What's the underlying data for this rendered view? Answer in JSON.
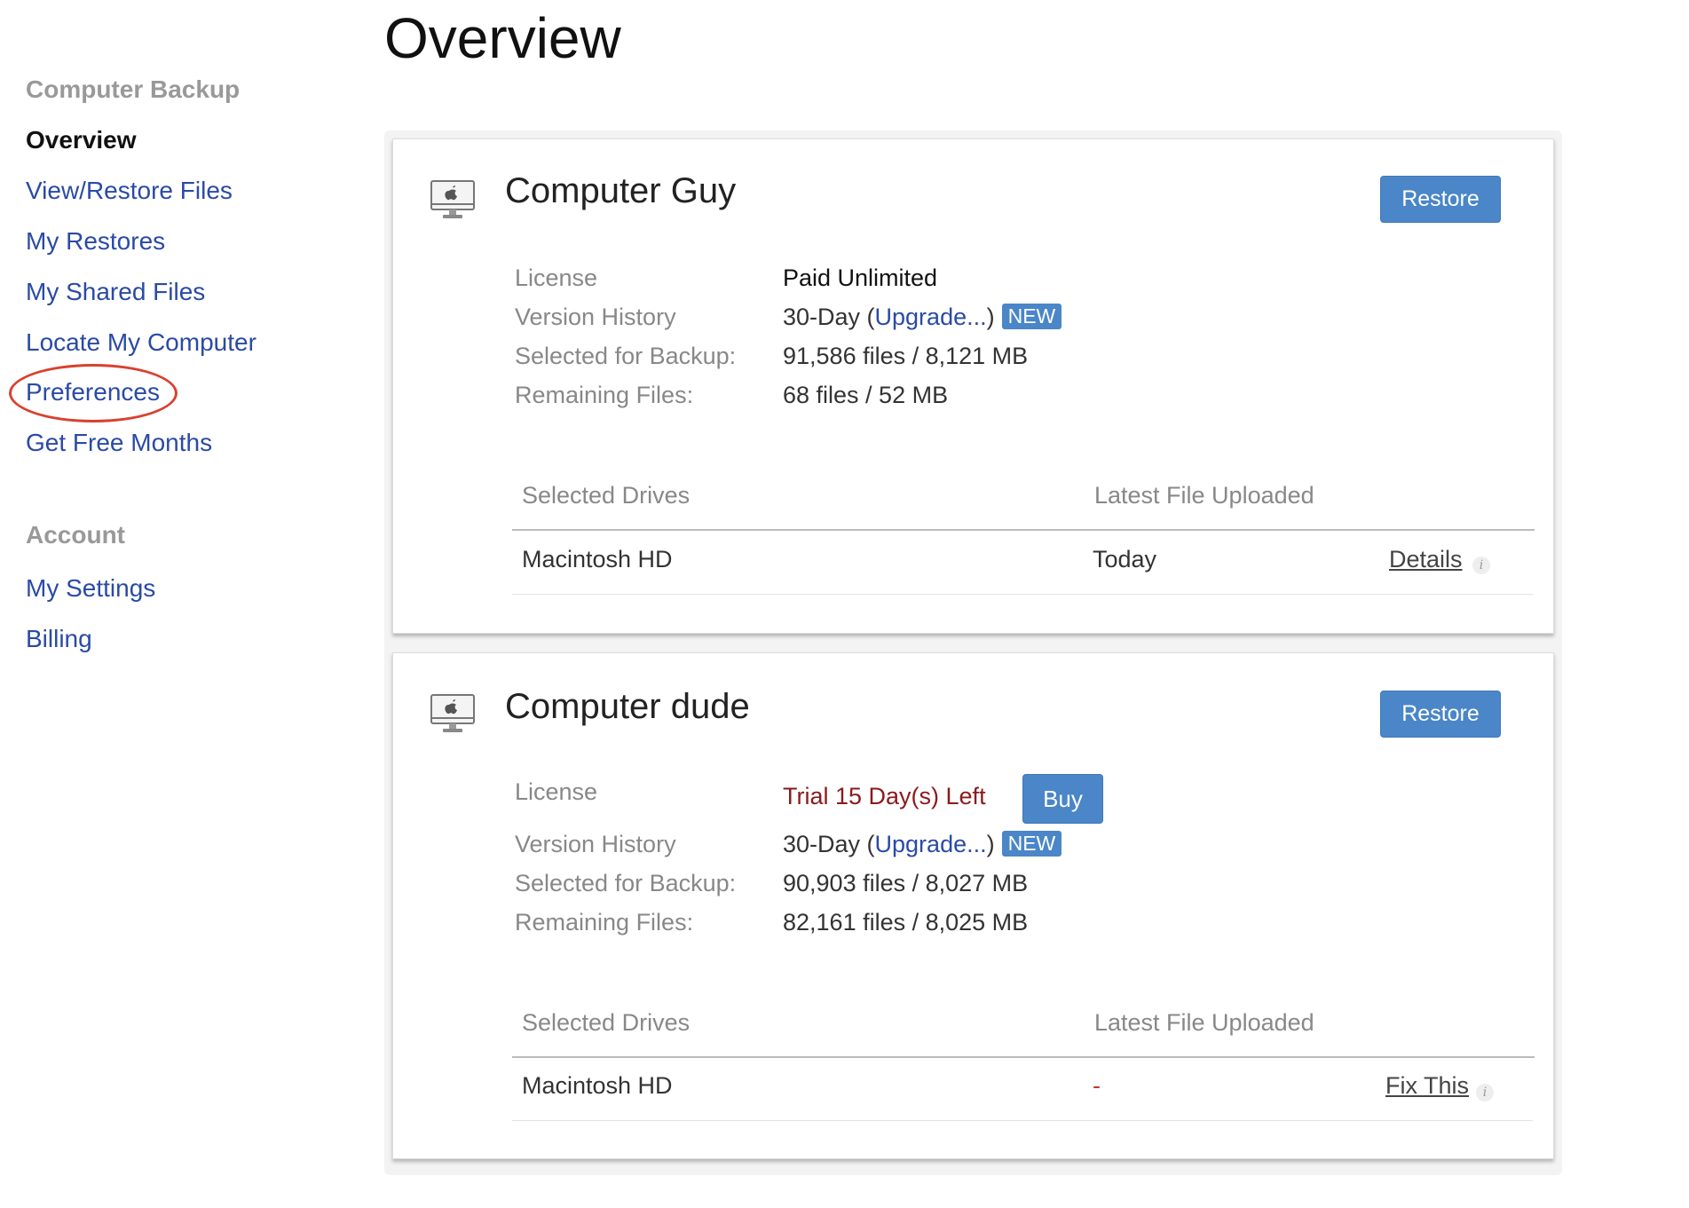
{
  "page": {
    "title": "Overview"
  },
  "sidebar": {
    "section_backup": "Computer Backup",
    "items_backup": [
      {
        "label": "Overview",
        "active": true
      },
      {
        "label": "View/Restore Files"
      },
      {
        "label": "My Restores"
      },
      {
        "label": "My Shared Files"
      },
      {
        "label": "Locate My Computer"
      },
      {
        "label": "Preferences",
        "highlighted": true
      },
      {
        "label": "Get Free Months"
      }
    ],
    "section_account": "Account",
    "items_account": [
      {
        "label": "My Settings"
      },
      {
        "label": "Billing"
      }
    ]
  },
  "computers": [
    {
      "name": "Computer Guy",
      "restore_label": "Restore",
      "license_label": "License",
      "license_value": "Paid Unlimited",
      "version_label": "Version History",
      "version_prefix": "30-Day (",
      "version_link": "Upgrade...",
      "version_suffix": ")",
      "version_badge": "NEW",
      "selected_label": "Selected for Backup:",
      "selected_value": "91,586 files / 8,121 MB",
      "remaining_label": "Remaining Files:",
      "remaining_value": "68 files / 52 MB",
      "col_drives": "Selected Drives",
      "col_latest": "Latest File Uploaded",
      "drive": "Macintosh HD",
      "latest": "Today",
      "action": "Details",
      "info_glyph": "i"
    },
    {
      "name": "Computer dude",
      "restore_label": "Restore",
      "license_label": "License",
      "license_value": "Trial 15 Day(s) Left",
      "buy_label": "Buy",
      "version_label": "Version History",
      "version_prefix": "30-Day (",
      "version_link": "Upgrade...",
      "version_suffix": ")",
      "version_badge": "NEW",
      "selected_label": "Selected for Backup:",
      "selected_value": "90,903 files / 8,027 MB",
      "remaining_label": "Remaining Files:",
      "remaining_value": "82,161 files / 8,025 MB",
      "col_drives": "Selected Drives",
      "col_latest": "Latest File Uploaded",
      "drive": "Macintosh HD",
      "latest": "-",
      "action": "Fix This",
      "info_glyph": "i"
    }
  ],
  "colors": {
    "accent": "#4a86c8",
    "link": "#2a4aa5",
    "trial": "#8b1a1a",
    "highlight_ring": "#d9412e"
  },
  "icons": {
    "computer": "imac-computer-icon",
    "info": "info-icon"
  }
}
